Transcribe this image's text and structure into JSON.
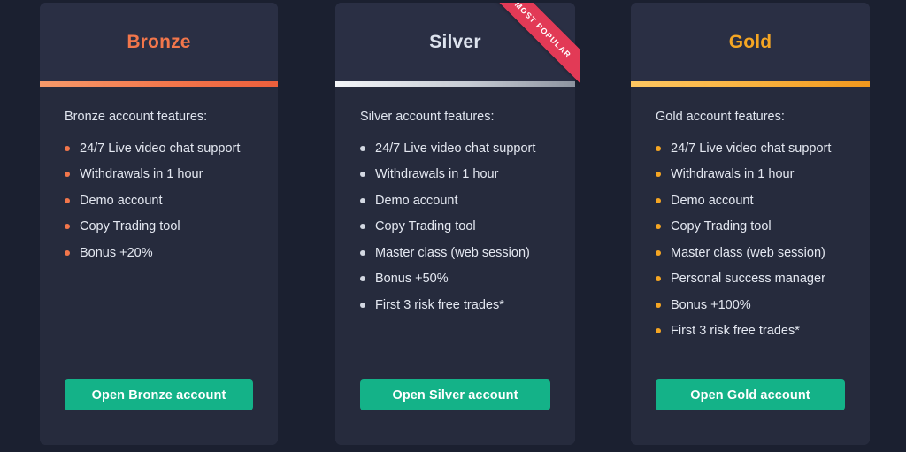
{
  "theme": {
    "page_background": "#1b2030",
    "card_header_background": "#2a2f44",
    "card_body_background": "#262b3d",
    "cta_color": "#14b288",
    "ribbon_color": "#e23a56",
    "bronze_accent": "#f2764b",
    "silver_accent": "#d3d8e2",
    "gold_accent": "#f5a623"
  },
  "plans": [
    {
      "id": "bronze",
      "title": "Bronze",
      "features_heading": "Bronze account features:",
      "features": [
        "24/7 Live video chat support",
        "Withdrawals in 1 hour",
        "Demo account",
        "Copy Trading tool",
        "Bonus +20%"
      ],
      "cta_label": "Open Bronze account",
      "ribbon": null
    },
    {
      "id": "silver",
      "title": "Silver",
      "features_heading": "Silver account features:",
      "features": [
        "24/7 Live video chat support",
        "Withdrawals in 1 hour",
        "Demo account",
        "Copy Trading tool",
        "Master class (web session)",
        "Bonus +50%",
        "First 3 risk free trades*"
      ],
      "cta_label": "Open Silver account",
      "ribbon": "MOST POPULAR"
    },
    {
      "id": "gold",
      "title": "Gold",
      "features_heading": "Gold account features:",
      "features": [
        "24/7 Live video chat support",
        "Withdrawals in 1 hour",
        "Demo account",
        "Copy Trading tool",
        "Master class (web session)",
        "Personal success manager",
        "Bonus +100%",
        "First 3 risk free trades*"
      ],
      "cta_label": "Open Gold account",
      "ribbon": null
    }
  ]
}
